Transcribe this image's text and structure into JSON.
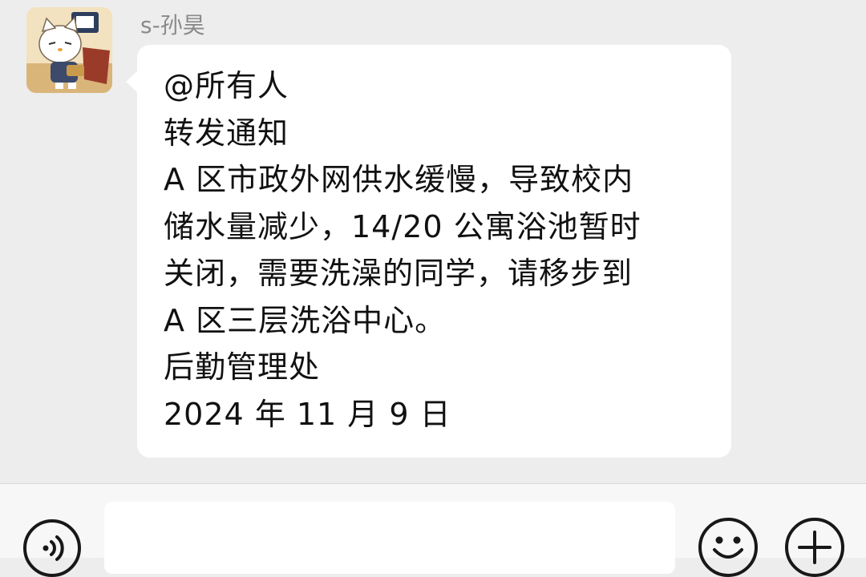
{
  "chat": {
    "sender_name": "s-孙昊",
    "message_lines": [
      "@所有人",
      "转发通知",
      "A 区市政外网供水缓慢，导致校内",
      "储水量减少，14/20 公寓浴池暂时",
      "关闭，需要洗澡的同学，请移步到",
      "A 区三层洗浴中心。",
      "后勤管理处",
      "2024 年 11 月 9 日"
    ]
  },
  "input_bar": {
    "voice_icon": "voice-icon",
    "emoji_icon": "emoji-icon",
    "plus_icon": "plus-icon",
    "input_value": ""
  },
  "colors": {
    "chat_background": "#ededed",
    "bubble": "#ffffff",
    "input_bar": "#f7f7f7"
  }
}
